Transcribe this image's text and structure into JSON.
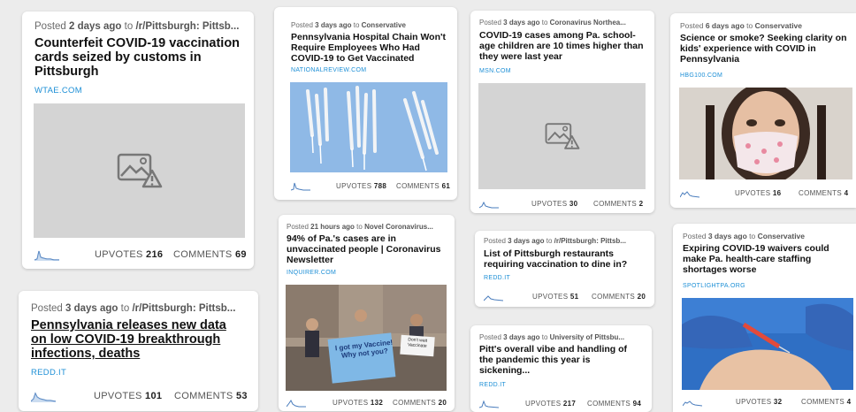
{
  "stat_labels": {
    "upvotes": "UPVOTES",
    "comments": "COMMENTS"
  },
  "cards": [
    {
      "posted": "Posted",
      "age": "2 days ago",
      "to": "to",
      "sub": "/r/Pittsburgh: Pittsb...",
      "title": "Counterfeit COVID-19 vaccination cards seized by customs in Pittsburgh",
      "domain": "WTAE.COM",
      "upvotes": "216",
      "comments": "69",
      "image": "placeholder-icon"
    },
    {
      "posted": "Posted",
      "age": "3 days ago",
      "to": "to",
      "sub": "/r/Pittsburgh: Pittsb...",
      "title": "Pennsylvania releases new data on low COVID-19 breakthrough infections, deaths",
      "domain": "REDD.IT",
      "upvotes": "101",
      "comments": "53"
    },
    {
      "posted": "Posted",
      "age": "3 days ago",
      "to": "to",
      "sub": "Conservative",
      "title": "Pennsylvania Hospital Chain Won't Require Employees Who Had COVID-19 to Get Vaccinated",
      "domain": "NATIONALREVIEW.COM",
      "upvotes": "788",
      "comments": "61",
      "image": "syringes-photo"
    },
    {
      "posted": "Posted",
      "age": "21 hours ago",
      "to": "to",
      "sub": "Novel Coronavirus...",
      "title": "94% of Pa.'s cases are in unvaccinated people | Coronavirus Newsletter",
      "domain": "INQUIRER.COM",
      "upvotes": "132",
      "comments": "20",
      "image": "protest-photo",
      "signs": [
        "I got my Vaccine! Why not you?",
        "Don't wait Vaccinate"
      ]
    },
    {
      "posted": "Posted",
      "age": "3 days ago",
      "to": "to",
      "sub": "Coronavirus Northea...",
      "title": "COVID-19 cases among Pa. school-age children are 10 times higher than they were last year",
      "domain": "MSN.COM",
      "upvotes": "30",
      "comments": "2",
      "image": "placeholder-icon"
    },
    {
      "posted": "Posted",
      "age": "3 days ago",
      "to": "to",
      "sub": "/r/Pittsburgh: Pittsb...",
      "title": "List of Pittsburgh restaurants requiring vaccination to dine in?",
      "domain": "REDD.IT",
      "upvotes": "51",
      "comments": "20"
    },
    {
      "posted": "Posted",
      "age": "3 days ago",
      "to": "to",
      "sub": "University of Pittsbu...",
      "title": "Pitt's overall vibe and handling of the pandemic this year is sickening...",
      "domain": "REDD.IT",
      "upvotes": "217",
      "comments": "94"
    },
    {
      "posted": "Posted",
      "age": "6 days ago",
      "to": "to",
      "sub": "Conservative",
      "title": "Science or smoke? Seeking clarity on kids' experience with COVID in Pennsylvania",
      "domain": "HBG100.COM",
      "upvotes": "16",
      "comments": "4",
      "image": "child-mask-photo"
    },
    {
      "posted": "Posted",
      "age": "3 days ago",
      "to": "to",
      "sub": "Conservative",
      "title": "Expiring COVID-19 waivers could make Pa. health-care staffing shortages worse",
      "domain": "SPOTLIGHTPA.ORG",
      "upvotes": "32",
      "comments": "4",
      "image": "injection-photo"
    }
  ]
}
